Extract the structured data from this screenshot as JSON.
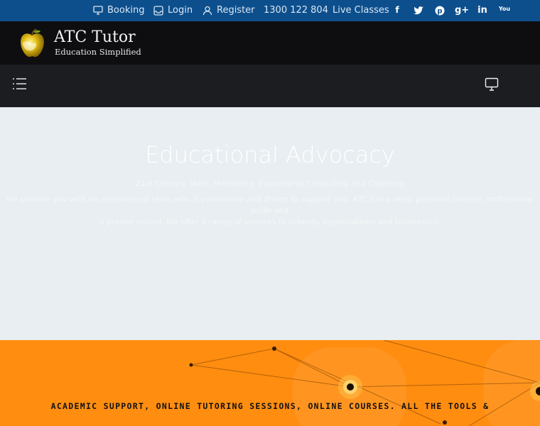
{
  "topbar": {
    "booking": "Booking",
    "login": "Login",
    "register": "Register",
    "phone": "1300 122 804",
    "live_classes": "Live Classes",
    "social": [
      "facebook-icon",
      "twitter-icon",
      "pinterest-icon",
      "google-plus-icon",
      "linkedin-icon",
      "youtube-icon"
    ],
    "social_glyphs": {
      "facebook": "f",
      "twitter": "t",
      "pinterest": "p",
      "gplus": "g+",
      "linkedin": "in",
      "youtube": "You"
    }
  },
  "brand": {
    "title": "ATC Tutor",
    "subtitle": "Education Simplified"
  },
  "hero": {
    "title": "Educational Advocacy",
    "subtitle": "21st Century Skills, Mentoring, Educational Consulting and Coaching",
    "body_line1": "We provide you with an experienced team who is passionate and driven to support you. ATC has a deep personal interest, professional pride and",
    "body_line2": "a proven record. We offer a range of services to schools, organisations and businesses."
  },
  "band": {
    "text": "ACADEMIC SUPPORT, ONLINE TUTORING SESSIONS, ONLINE COURSES. ALL THE TOOLS &"
  },
  "colors": {
    "topbar": "#0d4f8c",
    "brandbar": "#0e0e10",
    "navbar": "#1c1d20",
    "hero": "#e8eef1",
    "band": "#ff8d10"
  }
}
